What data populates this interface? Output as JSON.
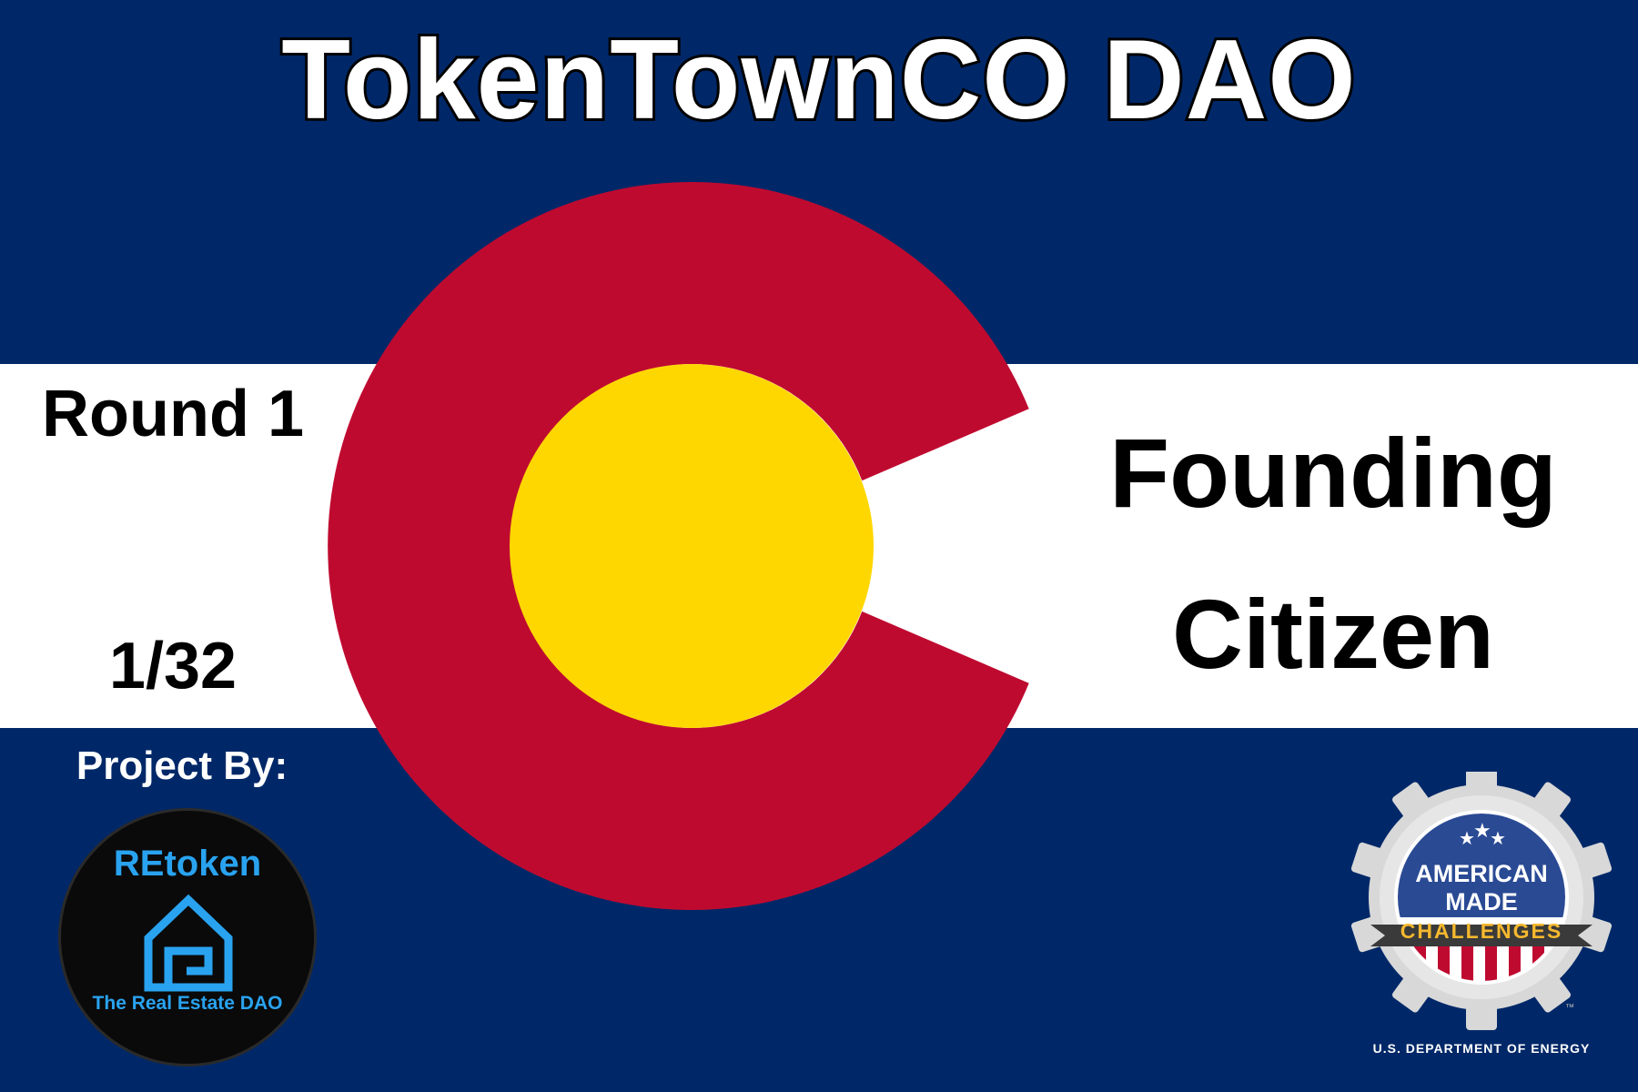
{
  "colors": {
    "blue": "#002868",
    "white": "#ffffff",
    "red": "#bf0a30",
    "gold": "#ffd700",
    "retoken_blue": "#29a3f0",
    "amc_gold": "#f5b82e"
  },
  "header": {
    "title": "TokenTownCO DAO"
  },
  "left_panel": {
    "round": "Round 1",
    "edition": "1/32",
    "project_by": "Project By:"
  },
  "right_panel": {
    "rank_line1": "Founding",
    "rank_line2": "Citizen"
  },
  "retoken_logo": {
    "name": "REtoken",
    "tagline": "The Real Estate DAO",
    "icon": "house-icon"
  },
  "amc_logo": {
    "line1": "AMERICAN",
    "line2": "MADE",
    "line3": "CHALLENGES",
    "department": "U.S. DEPARTMENT OF ENERGY",
    "trademark": "™",
    "icon": "gear-icon"
  }
}
